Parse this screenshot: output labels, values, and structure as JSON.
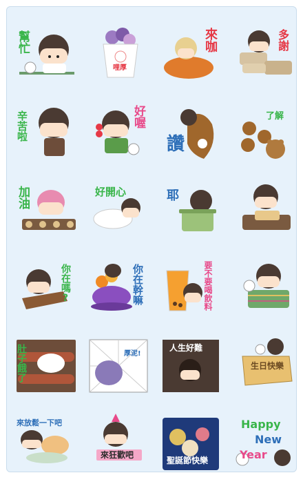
{
  "stickers": [
    {
      "id": "sticker-help",
      "text": "幫忙"
    },
    {
      "id": "sticker-dessert",
      "text": "哩厚"
    },
    {
      "id": "sticker-come-eat",
      "text": "來咖"
    },
    {
      "id": "sticker-thanks",
      "text": "多謝"
    },
    {
      "id": "sticker-hard-work",
      "text": "辛苦啦"
    },
    {
      "id": "sticker-good",
      "text": "好喔"
    },
    {
      "id": "sticker-praise",
      "text": "讚"
    },
    {
      "id": "sticker-understand",
      "text": "了解"
    },
    {
      "id": "sticker-add-oil",
      "text": "加油"
    },
    {
      "id": "sticker-happy",
      "text": "好開心"
    },
    {
      "id": "sticker-yeah",
      "text": "耶"
    },
    {
      "id": "sticker-tofu",
      "text": ""
    },
    {
      "id": "sticker-are-you-there",
      "text": "你在嗎?"
    },
    {
      "id": "sticker-icecream",
      "text": "你在幹嘛"
    },
    {
      "id": "sticker-drink",
      "text": "要不要喝飲料"
    },
    {
      "id": "sticker-basket",
      "text": ""
    },
    {
      "id": "sticker-hungry",
      "text": "肚子餓了"
    },
    {
      "id": "sticker-shy",
      "text": "厚泥!"
    },
    {
      "id": "sticker-life-hard",
      "text": "人生好難"
    },
    {
      "id": "sticker-cake",
      "text": "生日快樂"
    },
    {
      "id": "sticker-come-play",
      "text": "來放鬆一下吧"
    },
    {
      "id": "sticker-welcome",
      "text": "來狂歡吧"
    },
    {
      "id": "sticker-xmas",
      "text": "聖誕節快樂"
    },
    {
      "id": "sticker-new-year",
      "line1": "Happy",
      "line2": "New",
      "line3": "Year"
    }
  ],
  "colors": {
    "panel": "#e7f2fb",
    "green": "#39b54a",
    "red": "#e63946",
    "pink": "#e84a8a",
    "blue": "#2e6fb8",
    "purple": "#8a4fbf",
    "orange": "#f08a24"
  }
}
